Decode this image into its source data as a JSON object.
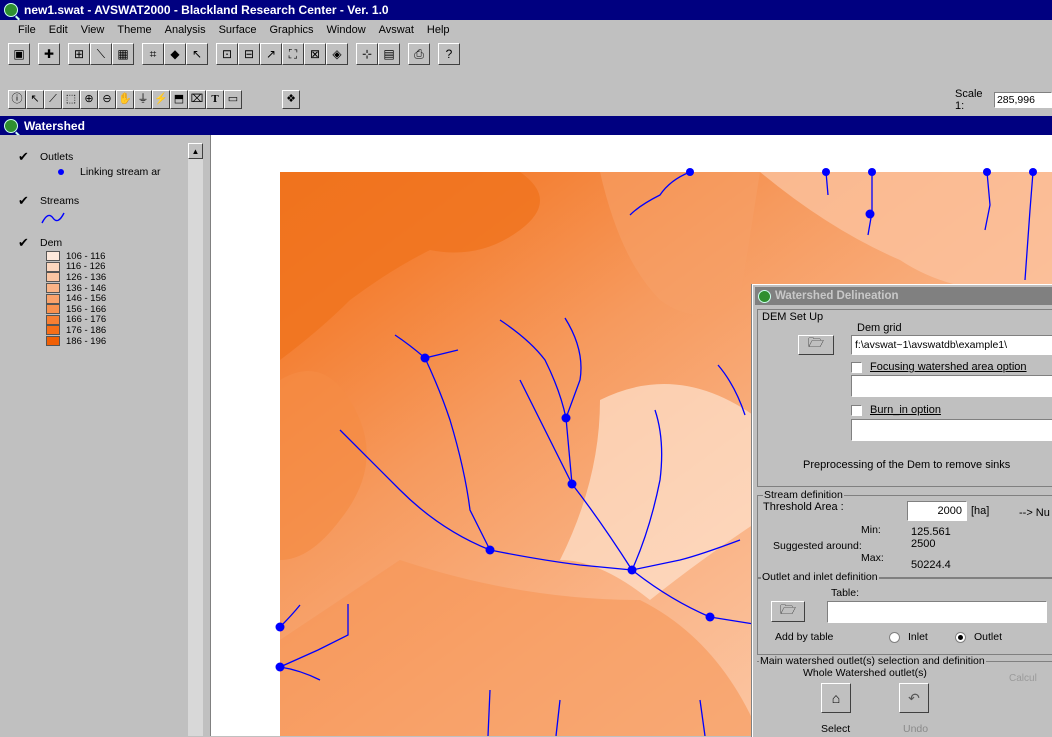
{
  "app": {
    "title": "new1.swat - AVSWAT2000 - Blackland Research Center - Ver. 1.0"
  },
  "menu": [
    "File",
    "Edit",
    "View",
    "Theme",
    "Analysis",
    "Surface",
    "Graphics",
    "Window",
    "Avswat",
    "Help"
  ],
  "toolbar": {
    "scale_label": "Scale 1:",
    "scale_value": "285,996"
  },
  "view_window": {
    "title": "Watershed"
  },
  "toc": {
    "themes": [
      {
        "name": "Outlets",
        "legend": "Linking stream ar",
        "color": "#0000ff"
      },
      {
        "name": "Streams",
        "color": "#0000ff"
      },
      {
        "name": "Dem",
        "classes": [
          {
            "label": "106 - 116",
            "color": "#fde9dc"
          },
          {
            "label": "116 - 126",
            "color": "#fcd7bf"
          },
          {
            "label": "126 - 136",
            "color": "#fbc6a3"
          },
          {
            "label": "136 - 146",
            "color": "#fab487"
          },
          {
            "label": "146 - 156",
            "color": "#f9a26b"
          },
          {
            "label": "156 - 166",
            "color": "#f8914f"
          },
          {
            "label": "166 - 176",
            "color": "#f77f33"
          },
          {
            "label": "176 - 186",
            "color": "#f66e18"
          },
          {
            "label": "186 - 196",
            "color": "#f05f05"
          }
        ]
      }
    ]
  },
  "dialog": {
    "title": "Watershed Delineation",
    "dem_setup": {
      "group": "DEM Set Up",
      "dem_grid_label": "Dem grid",
      "dem_grid_value": "f:\\avswat~1\\avswatdb\\example1\\",
      "focusing_label": "Focusing watershed  area option",
      "focusing_value": "",
      "burn_label": "Burn_in option",
      "burn_value": "",
      "preprocess_label": "Preprocessing of the Dem to remove sinks"
    },
    "stream_definition": {
      "group": "Stream definition",
      "threshold_label": "Threshold Area :",
      "threshold_value": "2000",
      "threshold_unit": "[ha]",
      "next_label": "--> Nu",
      "min_label": "Min:",
      "min_value": "125.561",
      "suggested_label": "Suggested around:",
      "suggested_value": "2500",
      "max_label": "Max:",
      "max_value": "50224.4"
    },
    "outlet_definition": {
      "group": "Outlet  and inlet definition",
      "table_label": "Table:",
      "table_value": "",
      "add_by_table": "Add by table",
      "inlet": "Inlet",
      "outlet": "Outlet",
      "selected": "Outlet"
    },
    "main_outlet": {
      "group": "Main watershed  outlet(s) selection and definition",
      "whole_label": "Whole Watershed outlet(s)",
      "calc_label": "Calcul",
      "select_label": "Select",
      "undo_label": "Undo"
    }
  },
  "colors": {
    "title_bar": "#000080",
    "stream": "#0000ff",
    "window_bg": "#c0c0c0",
    "dialog_title": "#808080"
  }
}
